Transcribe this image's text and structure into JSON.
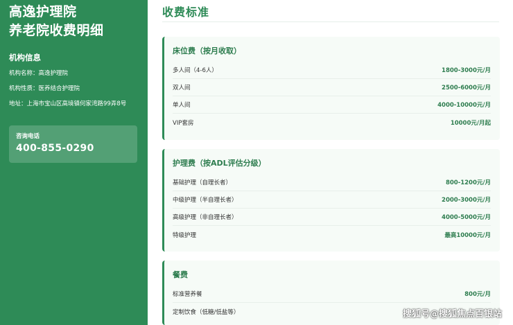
{
  "sidebar": {
    "title_line1": "高逸护理院",
    "title_line2": "养老院收费明细",
    "section_title": "机构信息",
    "info": [
      "机构名称：高逸护理院",
      "机构性质：医养结合护理院",
      "地址：上海市宝山区高境镇何家湾路99弄8号"
    ],
    "contact_label": "咨询电话",
    "contact_phone": "400-855-0290"
  },
  "main": {
    "title": "收费标准",
    "cards": [
      {
        "title": "床位费（按月收取）",
        "rows": [
          {
            "label": "多人间（4-6人）",
            "price": "1800-3000元/月"
          },
          {
            "label": "双人间",
            "price": "2500-6000元/月"
          },
          {
            "label": "单人间",
            "price": "4000-10000元/月"
          },
          {
            "label": "VIP套房",
            "price": "10000元/月起"
          }
        ]
      },
      {
        "title": "护理费（按ADL评估分级）",
        "rows": [
          {
            "label": "基础护理（自理长者）",
            "price": "800-1200元/月"
          },
          {
            "label": "中级护理（半自理长者）",
            "price": "2000-3000元/月"
          },
          {
            "label": "高级护理（非自理长者）",
            "price": "4000-5000元/月"
          },
          {
            "label": "特级护理",
            "price": "最高10000元/月"
          }
        ]
      },
      {
        "title": "餐费",
        "rows": [
          {
            "label": "标准营养餐",
            "price": "800元/月"
          },
          {
            "label": "定制饮食（低糖/低盐等）",
            "price": ""
          }
        ]
      }
    ]
  },
  "watermark": "搜狐号@搜狐焦点百银站",
  "colors": {
    "accent": "#2e8b57",
    "card_bg": "#f6fbf7",
    "price": "#2e7d4f"
  }
}
